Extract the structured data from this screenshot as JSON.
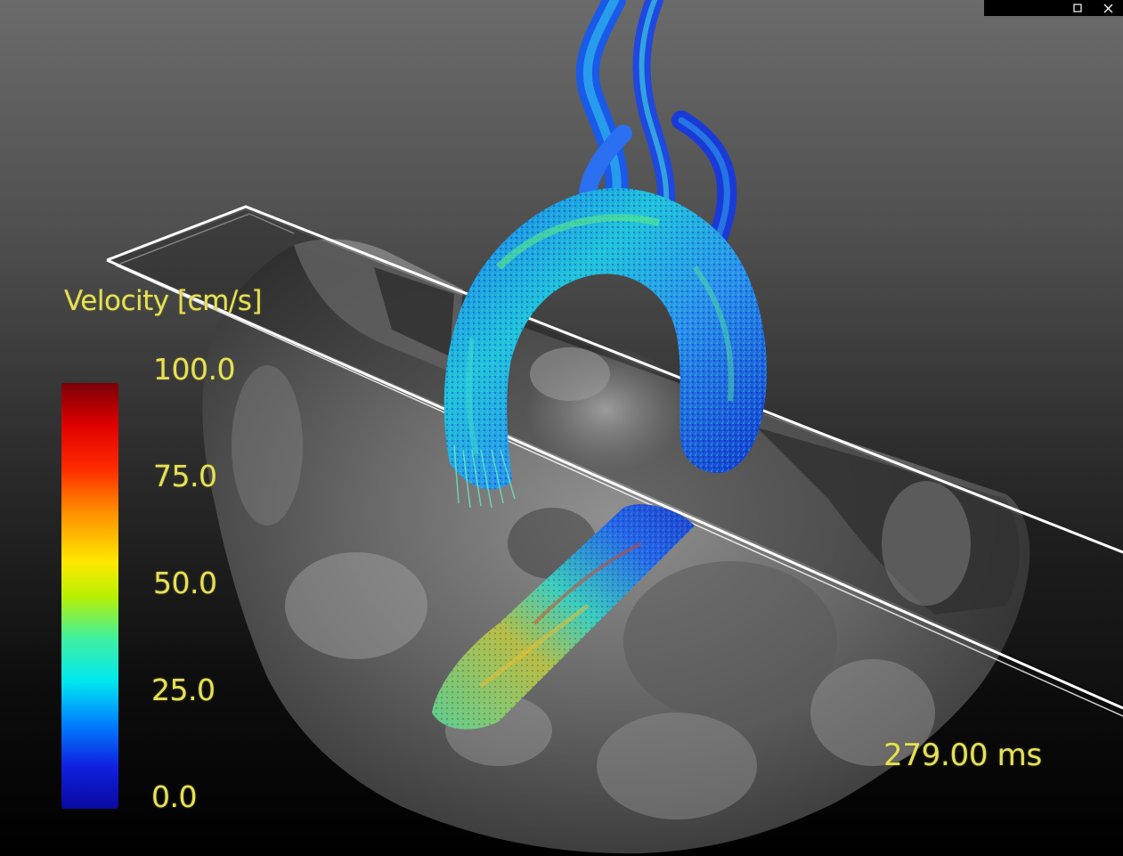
{
  "window": {
    "controls": [
      {
        "name": "maximize",
        "icon": "maximize-icon"
      },
      {
        "name": "close",
        "icon": "close-icon"
      }
    ]
  },
  "legend": {
    "title": "Velocity [cm/s]",
    "ticks": [
      "100.0",
      "75.0",
      "50.0",
      "25.0",
      "0.0"
    ],
    "range": [
      0,
      100
    ],
    "colormap": [
      "#0a0aa0",
      "#0080ff",
      "#00e8f0",
      "#b8f000",
      "#ffe800",
      "#ff8c00",
      "#e00000",
      "#7a0008"
    ]
  },
  "readout": {
    "time": "279.00 ms"
  },
  "colors": {
    "label_text": "#e6e05a",
    "slice_outline": "#ffffff"
  }
}
